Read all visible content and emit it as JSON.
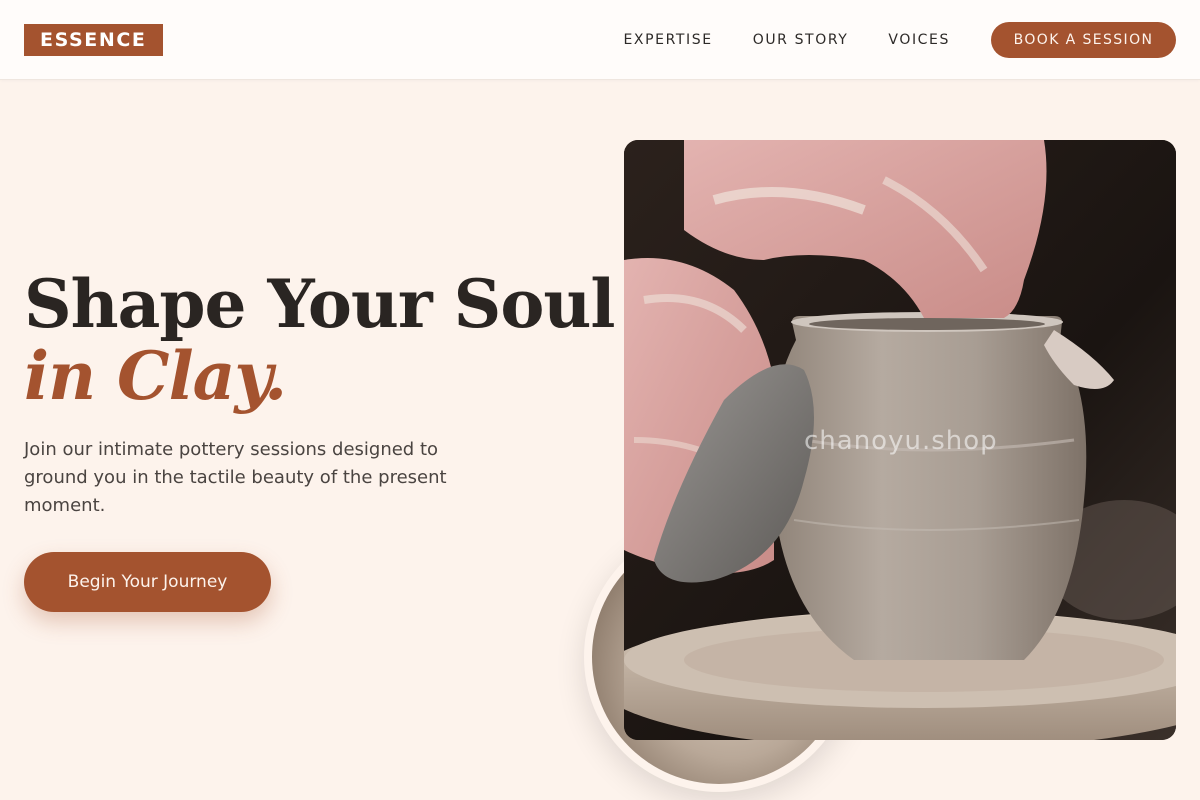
{
  "header": {
    "logo": "ESSENCE",
    "nav": [
      {
        "label": "EXPERTISE"
      },
      {
        "label": "OUR STORY"
      },
      {
        "label": "VOICES"
      }
    ],
    "book_button": "BOOK A SESSION"
  },
  "hero": {
    "headline_line1": "Shape Your Soul",
    "headline_line2": "in Clay.",
    "lede": "Join our intimate pottery sessions designed to ground you in the tactile beauty of the present moment.",
    "cta": "Begin Your Journey"
  },
  "media": {
    "main_photo": "pottery-wheel-hands-photo",
    "circle_photo": "clay-detail-photo",
    "watermark": "chanoyu.shop"
  },
  "colors": {
    "accent": "#a4532f",
    "background": "#fdf3ec",
    "text_dark": "#2a2522",
    "header_bg": "#fffcfa"
  }
}
